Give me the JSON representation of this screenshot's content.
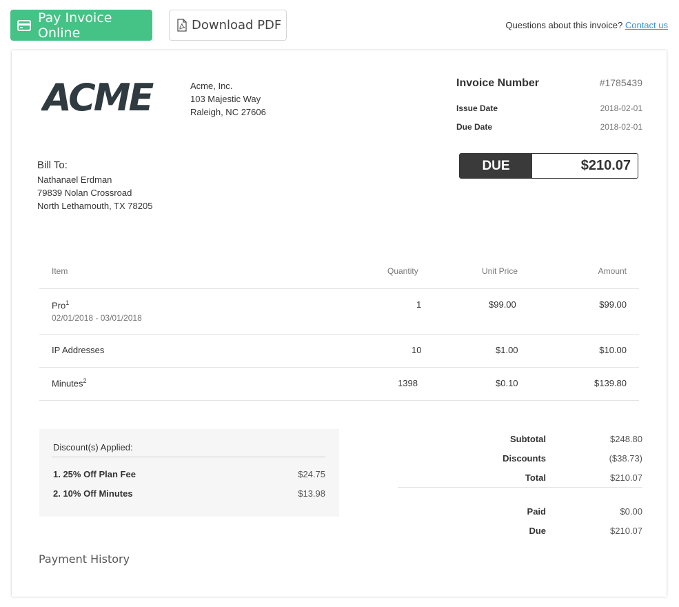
{
  "toolbar": {
    "pay_label": "Pay Invoice Online",
    "pdf_label": "Download PDF",
    "questions_text": "Questions about this invoice?",
    "contact_label": "Contact us"
  },
  "seller": {
    "logo_text": "ACME",
    "name": "Acme, Inc.",
    "address1": "103 Majestic Way",
    "address2": "Raleigh, NC 27606"
  },
  "invoice": {
    "number_label": "Invoice Number",
    "number": "#1785439",
    "issue_label": "Issue Date",
    "issue_date": "2018-02-01",
    "due_label": "Due Date",
    "due_date": "2018-02-01",
    "due_badge": "DUE",
    "due_amount": "$210.07"
  },
  "bill_to": {
    "label": "Bill To:",
    "name": "Nathanael Erdman",
    "address1": "79839 Nolan Crossroad",
    "address2": "North Lethamouth, TX 78205"
  },
  "items": {
    "headers": {
      "item": "Item",
      "quantity": "Quantity",
      "unit_price": "Unit Price",
      "amount": "Amount"
    },
    "rows": [
      {
        "name": "Pro",
        "sup": "1",
        "period": "02/01/2018 - 03/01/2018",
        "quantity": "1",
        "unit_price": "$99.00",
        "amount": "$99.00"
      },
      {
        "name": "IP Addresses",
        "sup": "",
        "period": "",
        "quantity": "10",
        "unit_price": "$1.00",
        "amount": "$10.00"
      },
      {
        "name": "Minutes",
        "sup": "2",
        "period": "",
        "quantity": "1398",
        "unit_price": "$0.10",
        "amount": "$139.80"
      }
    ]
  },
  "discounts": {
    "title": "Discount(s) Applied:",
    "items": [
      {
        "label": "1. 25% Off Plan Fee",
        "amount": "$24.75"
      },
      {
        "label": "2. 10% Off Minutes",
        "amount": "$13.98"
      }
    ]
  },
  "totals": {
    "subtotal_label": "Subtotal",
    "subtotal": "$248.80",
    "discounts_label": "Discounts",
    "discounts": "($38.73)",
    "total_label": "Total",
    "total": "$210.07",
    "paid_label": "Paid",
    "paid": "$0.00",
    "due_label": "Due",
    "due": "$210.07"
  },
  "payment_history_label": "Payment History"
}
